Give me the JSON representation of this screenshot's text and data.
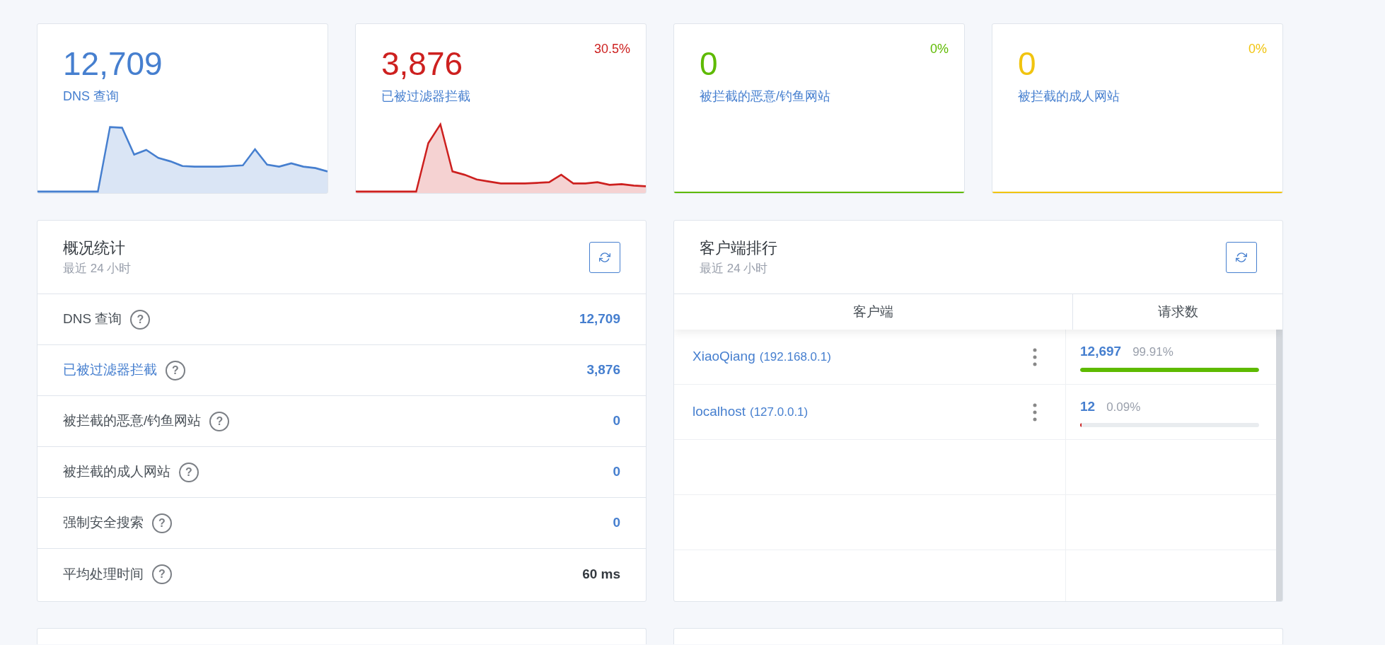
{
  "top_cards": [
    {
      "value": "12,709",
      "label": "DNS 查询",
      "color": "#467fcf",
      "kind": "sparkline"
    },
    {
      "value": "3,876",
      "label": "已被过滤器拦截",
      "percent": "30.5%",
      "color": "#cd201f",
      "kind": "sparkline"
    },
    {
      "value": "0",
      "label": "被拦截的恶意/钓鱼网站",
      "percent": "0%",
      "color": "#5eba00",
      "kind": "flat"
    },
    {
      "value": "0",
      "label": "被拦截的成人网站",
      "percent": "0%",
      "color": "#f1c40f",
      "kind": "flat"
    }
  ],
  "stats": {
    "title": "概况统计",
    "subtitle": "最近 24 小时",
    "rows": [
      {
        "label": "DNS 查询",
        "help": "?",
        "value": "12,709",
        "label_link": false,
        "value_link": true
      },
      {
        "label": "已被过滤器拦截",
        "help": "?",
        "value": "3,876",
        "label_link": true,
        "value_link": true
      },
      {
        "label": "被拦截的恶意/钓鱼网站",
        "help": "?",
        "value": "0",
        "label_link": false,
        "value_link": true
      },
      {
        "label": "被拦截的成人网站",
        "help": "?",
        "value": "0",
        "label_link": false,
        "value_link": true
      },
      {
        "label": "强制安全搜索",
        "help": "?",
        "value": "0",
        "label_link": false,
        "value_link": true
      },
      {
        "label": "平均处理时间",
        "help": "?",
        "value": "60 ms",
        "label_link": false,
        "value_link": false
      }
    ]
  },
  "clients": {
    "title": "客户端排行",
    "subtitle": "最近 24 小时",
    "columns": [
      "客户端",
      "请求数"
    ],
    "rows": [
      {
        "name": "XiaoQiang",
        "ip": "(192.168.0.1)",
        "count": "12,697",
        "percent": "99.91%",
        "level": 0.9991,
        "color": "#5eba00"
      },
      {
        "name": "localhost",
        "ip": "(127.0.0.1)",
        "count": "12",
        "percent": "0.09%",
        "level": 0.0009,
        "color": "#cd201f"
      }
    ]
  }
}
